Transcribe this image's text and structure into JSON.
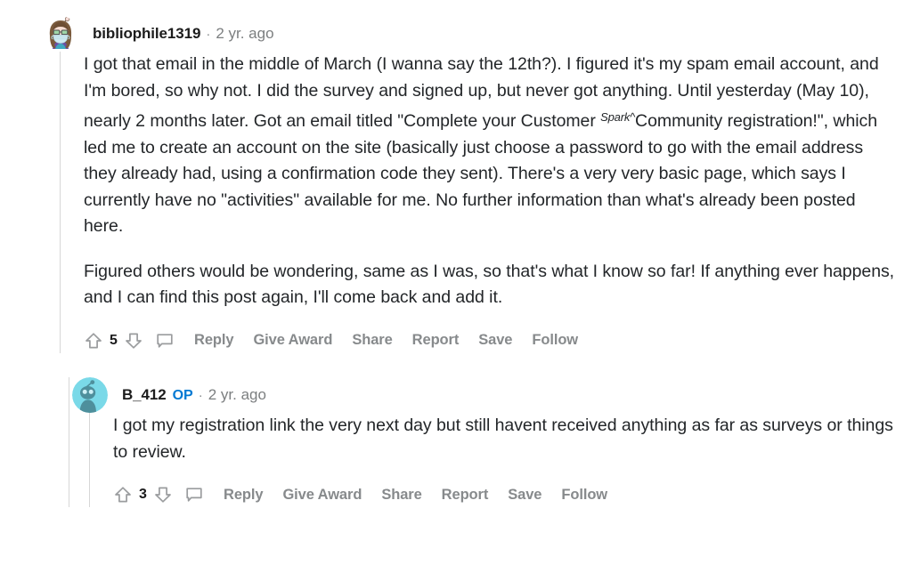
{
  "thread": {
    "comments": [
      {
        "username": "bibliophile1319",
        "op_badge": "",
        "separator": "·",
        "timestamp": "2 yr. ago",
        "avatar_type": "custom-snoo-masked",
        "paragraph_1_part_a": "I got that email in the middle of March (I wanna say the 12th?). I figured it's my spam email account, and I'm bored, so why not. I did the survey and signed up, but never got anything. Until yesterday (May 10), nearly 2 months later. Got an email titled \"Complete your Customer ",
        "paragraph_1_superscript": "Spark^",
        "paragraph_1_part_b": "Community registration!\", which led me to create an account on the site (basically just choose a password to go with the email address they already had, using a confirmation code they sent). There's a very very basic page, which says I currently have no \"activities\" available for me. No further information than what's already been posted here.",
        "paragraph_2": "Figured others would be wondering, same as I was, so that's what I know so far! If anything ever happens, and I can find this post again, I'll come back and add it.",
        "score": "5",
        "actions": [
          "Reply",
          "Give Award",
          "Share",
          "Report",
          "Save",
          "Follow"
        ]
      },
      {
        "username": "B_412",
        "op_badge": "OP",
        "separator": "·",
        "timestamp": "2 yr. ago",
        "avatar_type": "default-snoo-cyan",
        "paragraph_1": "I got my registration link the very next day but still havent received anything as far as surveys or things to review.",
        "score": "3",
        "actions": [
          "Reply",
          "Give Award",
          "Share",
          "Report",
          "Save",
          "Follow"
        ]
      }
    ]
  },
  "colors": {
    "text": "#232629",
    "muted": "#878a8c",
    "op_blue": "#0079d3",
    "thread_line": "#d7d7d7",
    "background": "#ffffff"
  },
  "icons": {
    "upvote": "upvote-arrow-icon",
    "downvote": "downvote-arrow-icon",
    "comment": "comment-bubble-icon"
  }
}
